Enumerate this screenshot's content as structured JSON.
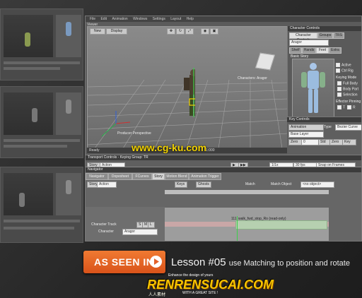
{
  "thumbnails": [
    {
      "id": "t1"
    },
    {
      "id": "t2"
    },
    {
      "id": "t3"
    }
  ],
  "menubar": {
    "items": [
      "File",
      "Edit",
      "Animation",
      "Windows",
      "Settings",
      "Layout",
      "Help"
    ]
  },
  "viewer": {
    "title": "Viewer",
    "toolbar": {
      "new": "New",
      "display": "Display"
    },
    "labels": {
      "perspective": "Producer Perspective",
      "camera": "Characters: Aragor"
    },
    "status": {
      "left": "Ready",
      "frame": "1:000"
    }
  },
  "character_controls": {
    "title": "Character Controls",
    "tabs": [
      "Character Controls",
      "Groups",
      "TRS"
    ],
    "char_field": "Aragor",
    "subtabs": [
      "Shelf",
      "Hands",
      "Feet",
      "Extra"
    ],
    "section": "Basic Story",
    "options": {
      "active": "Active",
      "ctrl_rig": "Ctrl Rig",
      "keying_mode": "Keying Mode",
      "full_body": "Full Body",
      "body_part": "Body Part",
      "selection": "Selection",
      "effector_pinning": "Effector Pinning",
      "translation": "T",
      "rotation": "R"
    }
  },
  "key_controls": {
    "title": "Key Controls",
    "animation_label": "Animation",
    "type_label": "Type",
    "type_value": "Bezier Curve",
    "base_layer": "Base Layer",
    "zero": "Zero",
    "value": "0",
    "std": "Std",
    "zero2": "Zero",
    "key": "Key"
  },
  "transport": {
    "title": "Transport Controls  -  Keying Group: TR",
    "story_label": "Story",
    "action_label": "Action",
    "fps_field": "1/1x",
    "fps": "30 fps",
    "snap": "Snap on Frames",
    "end": "100"
  },
  "navigator": {
    "title": "Navigator",
    "tabs": [
      "Navigator",
      "Dopesheet",
      "FCurves",
      "Story",
      "Motion Blend",
      "Animation Trigger"
    ],
    "active_tab": "Story",
    "toolbar": {
      "story": "Story",
      "action": "Action",
      "keys": "Keys",
      "ghosts": "Ghosts",
      "match": "Match",
      "match_object": "Match Object",
      "match_value": "<no object>"
    },
    "track": {
      "name": "Character Track",
      "character_label": "Character",
      "character_value": "Aragor",
      "clip": "walk_fwd_stop_Ro (read-only)",
      "clip_start": "111"
    }
  },
  "banner": {
    "button": "AS SEEN IN",
    "lesson_num": "Lesson #05",
    "lesson_desc": "use Matching to position and rotate"
  },
  "watermarks": {
    "top": "www.cg-ku.com",
    "brand": "RENRENSUCAI.COM",
    "small": "Enhance the design of yours",
    "cn": "人人素材",
    "slogan": "WITH A GREAT SITE !"
  },
  "colors": {
    "accent": "#e3612a",
    "track_green": "#6fd36f",
    "manipulator_yellow": "#f2d200"
  }
}
